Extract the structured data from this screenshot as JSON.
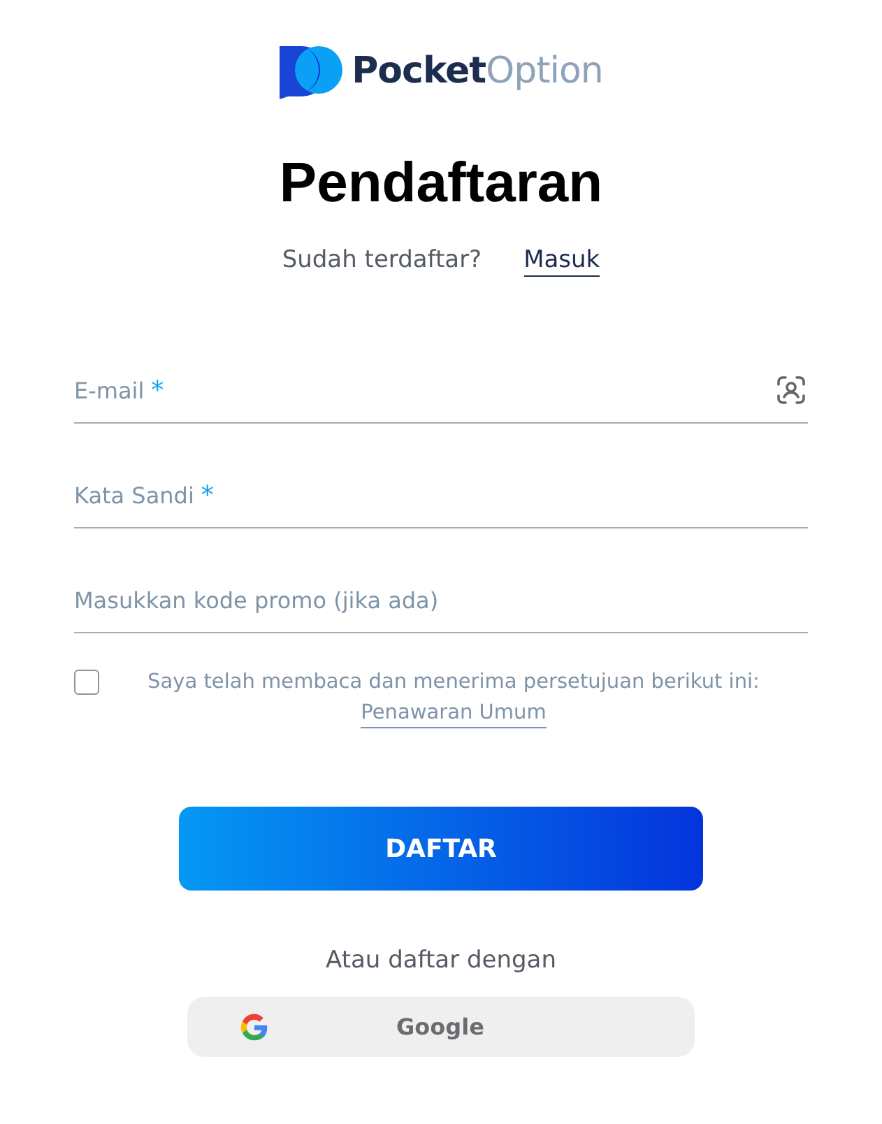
{
  "logo": {
    "text": "**Pocket**Option"
  },
  "title": "Pendaftaran",
  "login_prompt": {
    "text": "Sudah terdaftar?",
    "link": "Masuk"
  },
  "fields": [
    {
      "placeholder": "E-mail",
      "required_mark": "*",
      "contact_icon": true
    },
    {
      "placeholder": "Kata Sandi",
      "required_mark": "*",
      "contact_icon": false
    },
    {
      "placeholder": "Masukkan kode promo (jika ada)",
      "contact_icon": false
    }
  ],
  "agreement": {
    "checked": false,
    "text": "Saya telah membaca dan menerima persetujuan berikut ini:",
    "link": "Penawaran Umum"
  },
  "submit_button": "DAFTAR",
  "alt_prompt": "Atau daftar dengan",
  "social_buttons": [
    {
      "kind": "google",
      "label": "Google"
    }
  ]
}
